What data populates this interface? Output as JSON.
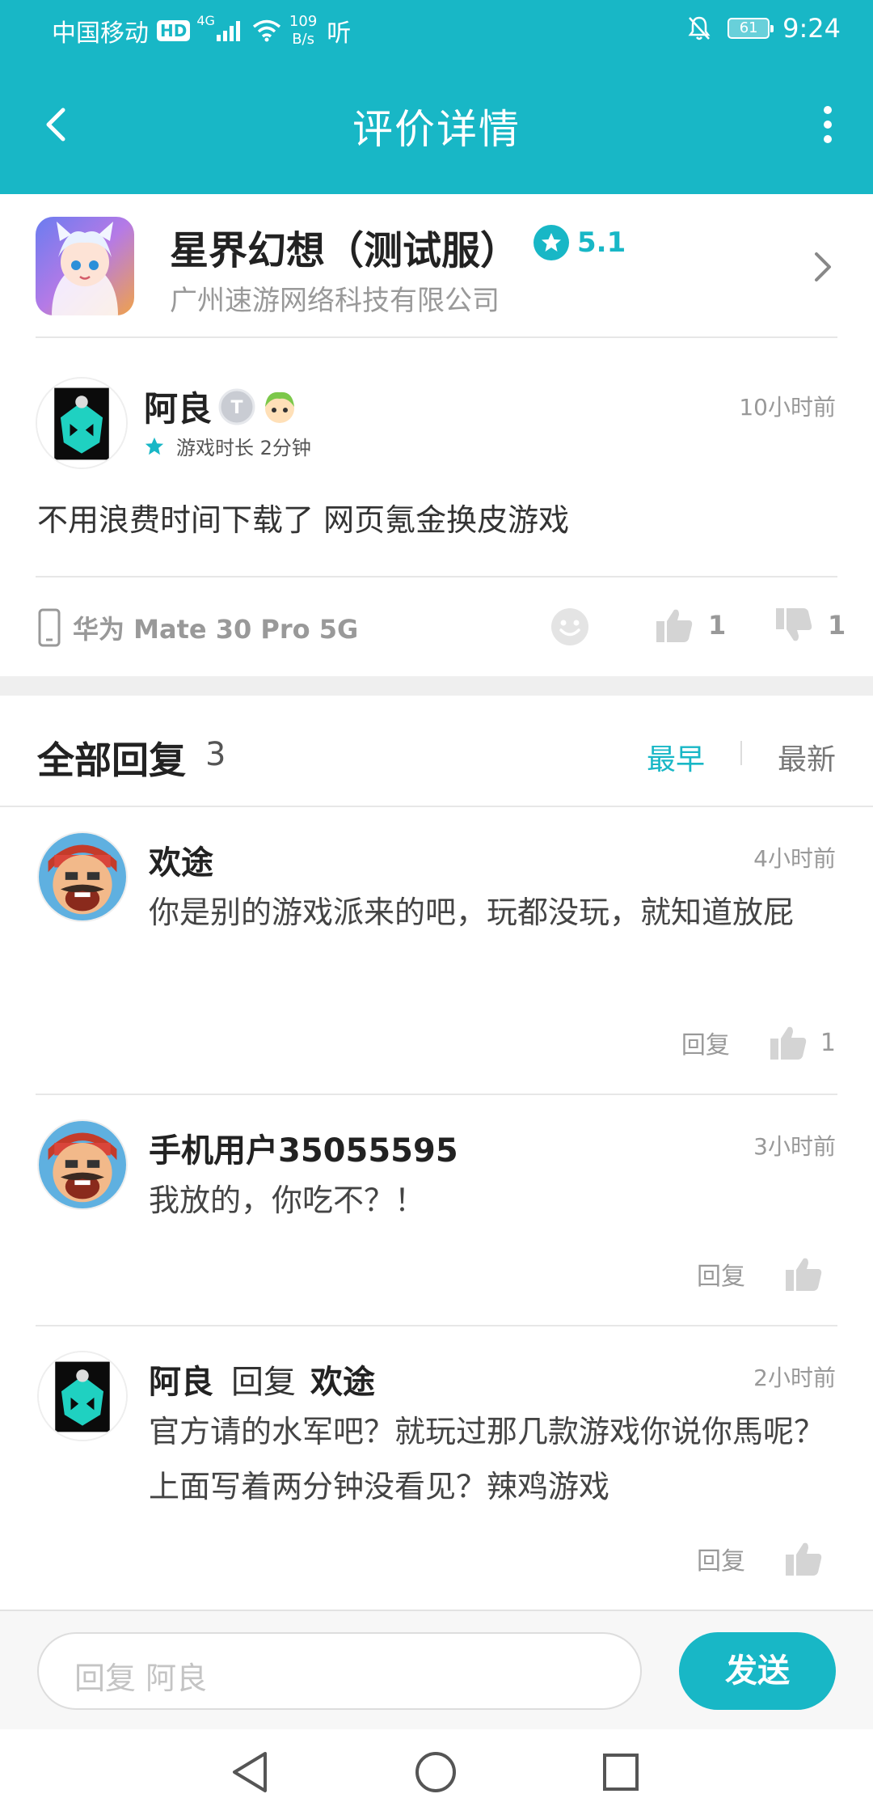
{
  "status_bar": {
    "carrier": "中国移动",
    "hd": "HD",
    "network": "4G",
    "speed_value": "109",
    "speed_unit": "B/s",
    "extra_icon": "听",
    "battery": "61",
    "time": "9:24"
  },
  "nav": {
    "title": "评价详情"
  },
  "game": {
    "name": "星界幻想（测试服）",
    "rating": "5.1",
    "developer": "广州速游网络科技有限公司"
  },
  "review": {
    "author": "阿良",
    "playtime": "游戏时长 2分钟",
    "time": "10小时前",
    "text": "不用浪费时间下载了 网页氪金换皮游戏",
    "device": "华为 Mate 30 Pro 5G",
    "likes": "1",
    "dislikes": "1"
  },
  "replies_header": {
    "title": "全部回复",
    "count": "3",
    "sort_early": "最早",
    "sort_latest": "最新"
  },
  "replies": [
    {
      "author": "欢途",
      "time": "4小时前",
      "text": "你是别的游戏派来的吧，玩都没玩，就知道放屁",
      "reply_label": "回复",
      "likes": "1"
    },
    {
      "author": "手机用户35055595",
      "time": "3小时前",
      "text": "我放的，你吃不？！",
      "reply_label": "回复"
    },
    {
      "author": "阿良",
      "reply_word": "回复",
      "target": "欢途",
      "time": "2小时前",
      "text": "官方请的水军吧？就玩过那几款游戏你说你馬呢？上面写着两分钟没看见？辣鸡游戏",
      "reply_label": "回复"
    }
  ],
  "bottom": {
    "placeholder": "回复 阿良",
    "send": "发送"
  },
  "colors": {
    "brand": "#18b7c6",
    "text_muted": "#999999"
  },
  "icons": {
    "back": "back-arrow-icon",
    "more": "more-vertical-icon",
    "rating": "star-icon",
    "device": "phone-icon",
    "emoji": "smiley-icon",
    "like": "thumbs-up-icon",
    "dislike": "thumbs-down-icon"
  }
}
